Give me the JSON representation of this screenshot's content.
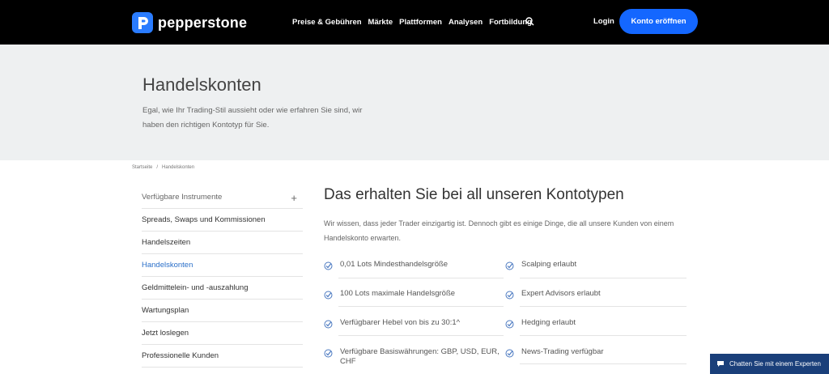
{
  "header": {
    "logo_text": "pepperstone",
    "nav": [
      "Preise & Gebühren",
      "Märkte",
      "Plattformen",
      "Analysen",
      "Fortbildung"
    ],
    "login": "Login",
    "cta": "Konto eröffnen"
  },
  "hero": {
    "title": "Handelskonten",
    "subtitle": "Egal, wie Ihr Trading-Stil aussieht oder wie erfahren Sie sind, wir haben den richtigen Kontotyp für Sie."
  },
  "breadcrumb": {
    "home": "Startseite",
    "separator": "/",
    "current": "Handelskonten"
  },
  "sidebar": {
    "items": [
      {
        "label": "Verfügbare Instrumente"
      },
      {
        "label": "Spreads, Swaps und Kommissionen"
      },
      {
        "label": "Handelszeiten"
      },
      {
        "label": "Handelskonten"
      },
      {
        "label": "Geldmittelein- und -auszahlung"
      },
      {
        "label": "Wartungsplan"
      },
      {
        "label": "Jetzt loslegen"
      },
      {
        "label": "Professionelle Kunden"
      }
    ],
    "plus": "+"
  },
  "main": {
    "title": "Das erhalten Sie bei all unseren Kontotypen",
    "intro": "Wir wissen, dass jeder Trader einzigartig ist. Dennoch gibt es einige Dinge, die all unsere Kunden von einem Handelskonto erwarten.",
    "features_left": [
      "0,01 Lots Mindesthandelsgröße",
      "100 Lots maximale Handelsgröße",
      "Verfügbarer Hebel von bis zu 30:1^",
      "Verfügbare Basiswährungen: GBP, USD, EUR, CHF"
    ],
    "features_right": [
      "Scalping erlaubt",
      "Expert Advisors erlaubt",
      "Hedging erlaubt",
      "News-Trading verfügbar"
    ]
  },
  "chat": {
    "label": "Chatten Sie mit einem Experten"
  },
  "colors": {
    "header_bg": "#000000",
    "accent": "#1467ff",
    "active_link": "#2a6fc9",
    "chat_bg": "#1a3f7a"
  }
}
